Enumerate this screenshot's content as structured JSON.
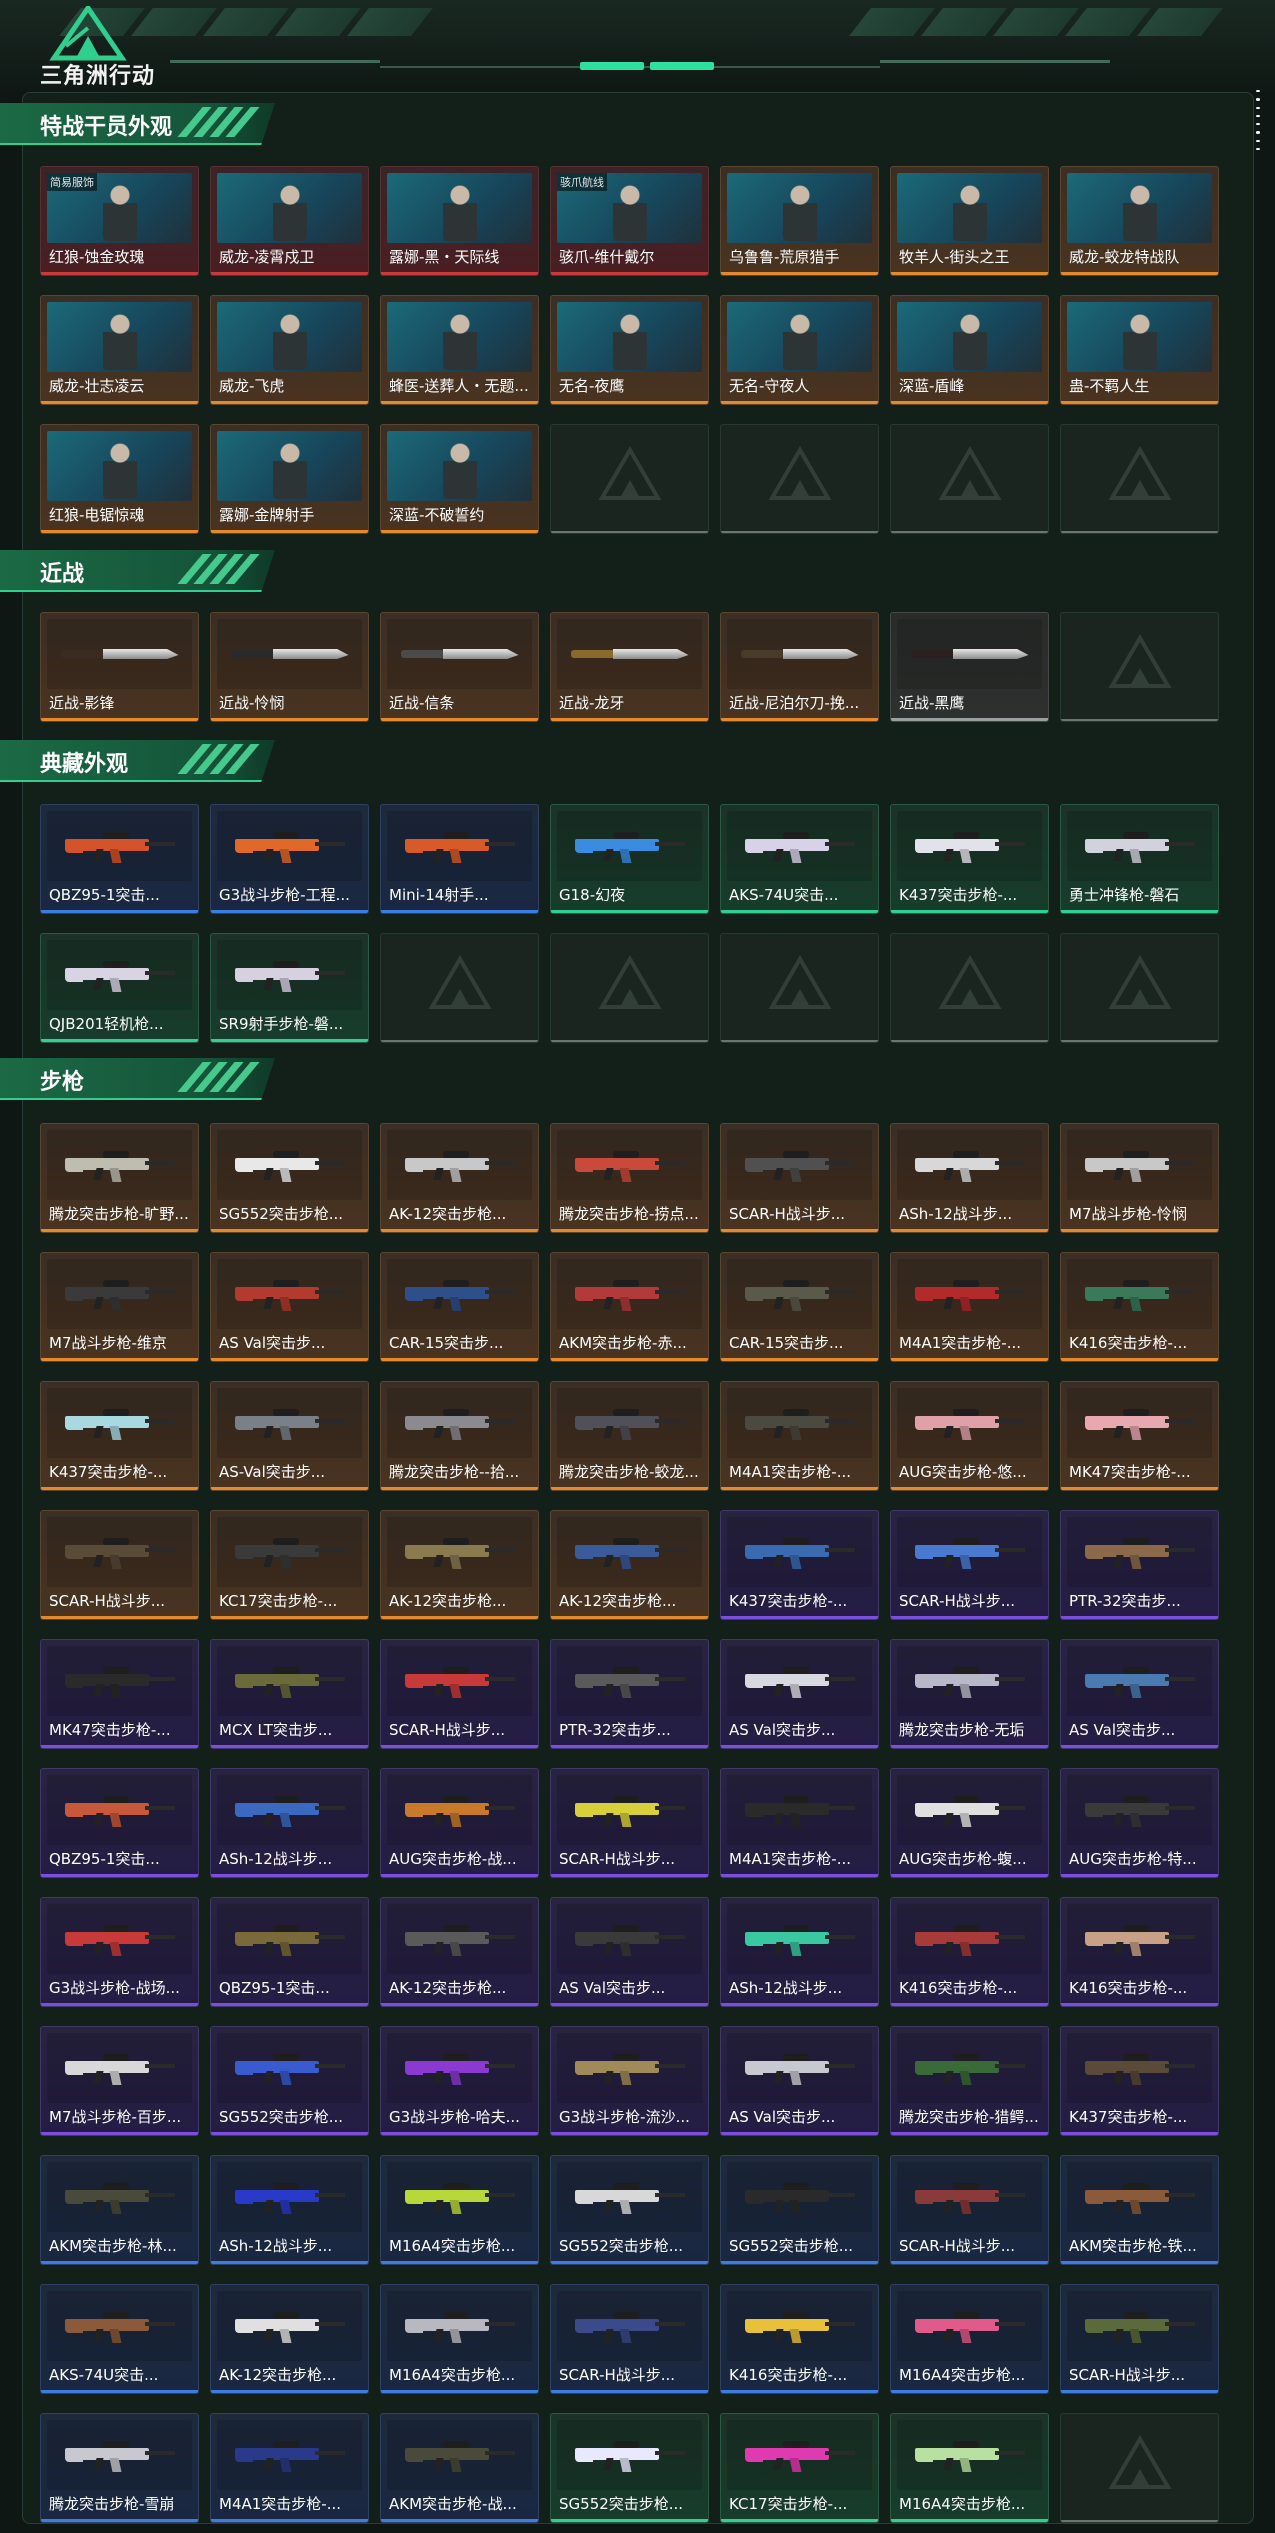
{
  "app": {
    "brand": "三角洲行动"
  },
  "sections": [
    {
      "id": "operators",
      "title": "特战干员外观",
      "kind": "operator",
      "items": [
        {
          "label": "红狼-蚀金玫瑰",
          "rarity": "red",
          "tag": "简易服饰"
        },
        {
          "label": "威龙-凌霄戍卫",
          "rarity": "red",
          "tag": ""
        },
        {
          "label": "露娜-黑・天际线",
          "rarity": "red",
          "tag": ""
        },
        {
          "label": "骇爪-维什戴尔",
          "rarity": "red",
          "tag": "骇爪航线"
        },
        {
          "label": "乌鲁鲁-荒原猎手",
          "rarity": "orange",
          "tag": ""
        },
        {
          "label": "牧羊人-街头之王",
          "rarity": "orange",
          "tag": ""
        },
        {
          "label": "威龙-蛟龙特战队",
          "rarity": "orange",
          "tag": ""
        },
        {
          "label": "威龙-壮志凌云",
          "rarity": "orange",
          "tag": ""
        },
        {
          "label": "威龙-飞虎",
          "rarity": "orange",
          "tag": ""
        },
        {
          "label": "蜂医-送葬人・无题...",
          "rarity": "orange",
          "tag": ""
        },
        {
          "label": "无名-夜鹰",
          "rarity": "orange",
          "tag": ""
        },
        {
          "label": "无名-守夜人",
          "rarity": "orange",
          "tag": ""
        },
        {
          "label": "深蓝-盾峰",
          "rarity": "orange",
          "tag": ""
        },
        {
          "label": "蛊-不羁人生",
          "rarity": "orange",
          "tag": ""
        },
        {
          "label": "红狼-电锯惊魂",
          "rarity": "orange",
          "tag": ""
        },
        {
          "label": "露娜-金牌射手",
          "rarity": "orange",
          "tag": ""
        },
        {
          "label": "深蓝-不破誓约",
          "rarity": "orange",
          "tag": ""
        },
        {
          "label": "",
          "rarity": "empty"
        },
        {
          "label": "",
          "rarity": "empty"
        },
        {
          "label": "",
          "rarity": "empty"
        },
        {
          "label": "",
          "rarity": "empty"
        }
      ]
    },
    {
      "id": "melee",
      "title": "近战",
      "kind": "knife",
      "items": [
        {
          "label": "近战-影锋",
          "rarity": "orange"
        },
        {
          "label": "近战-怜悯",
          "rarity": "orange"
        },
        {
          "label": "近战-信条",
          "rarity": "orange"
        },
        {
          "label": "近战-龙牙",
          "rarity": "orange"
        },
        {
          "label": "近战-尼泊尔刀-挽...",
          "rarity": "orange"
        },
        {
          "label": "近战-黑鹰",
          "rarity": "gray"
        },
        {
          "label": "",
          "rarity": "empty"
        }
      ]
    },
    {
      "id": "collection",
      "title": "典藏外观",
      "kind": "gun",
      "items": [
        {
          "label": "QBZ95-1突击...",
          "rarity": "blue",
          "color": "#d5532b"
        },
        {
          "label": "G3战斗步枪-工程...",
          "rarity": "blue",
          "color": "#e0692a"
        },
        {
          "label": "Mini-14射手...",
          "rarity": "blue",
          "color": "#d85a28"
        },
        {
          "label": "G18-幻夜",
          "rarity": "green",
          "color": "#3a8ce0"
        },
        {
          "label": "AKS-74U突击...",
          "rarity": "green",
          "color": "#d8d2e8"
        },
        {
          "label": "K437突击步枪-...",
          "rarity": "green",
          "color": "#e2e2ea"
        },
        {
          "label": "勇士冲锋枪-磐石",
          "rarity": "green",
          "color": "#d2d2dc"
        },
        {
          "label": "QJB201轻机枪...",
          "rarity": "green",
          "color": "#d8d4e4"
        },
        {
          "label": "SR9射手步枪-磐...",
          "rarity": "green",
          "color": "#d6d0e0"
        },
        {
          "label": "",
          "rarity": "empty"
        },
        {
          "label": "",
          "rarity": "empty"
        },
        {
          "label": "",
          "rarity": "empty"
        },
        {
          "label": "",
          "rarity": "empty"
        },
        {
          "label": "",
          "rarity": "empty"
        }
      ]
    },
    {
      "id": "rifles",
      "title": "步枪",
      "kind": "gun",
      "items": [
        {
          "label": "腾龙突击步枪-旷野...",
          "rarity": "orange",
          "color": "#bdbdb0"
        },
        {
          "label": "SG552突击步枪...",
          "rarity": "orange",
          "color": "#e8e8e8"
        },
        {
          "label": "AK-12突击步枪...",
          "rarity": "orange",
          "color": "#c8c8c8"
        },
        {
          "label": "腾龙突击步枪-捞点...",
          "rarity": "orange",
          "color": "#c94a3a"
        },
        {
          "label": "SCAR-H战斗步...",
          "rarity": "orange",
          "color": "#505050"
        },
        {
          "label": "ASh-12战斗步...",
          "rarity": "orange",
          "color": "#d8d8d8"
        },
        {
          "label": "M7战斗步枪-怜悯",
          "rarity": "orange",
          "color": "#c8c8c8"
        },
        {
          "label": "M7战斗步枪-维京",
          "rarity": "orange",
          "color": "#3a3a3a"
        },
        {
          "label": "AS Val突击步...",
          "rarity": "orange",
          "color": "#b23a2e"
        },
        {
          "label": "CAR-15突击步...",
          "rarity": "orange",
          "color": "#2f4f8a"
        },
        {
          "label": "AKM突击步枪-赤...",
          "rarity": "orange",
          "color": "#b23a3a"
        },
        {
          "label": "CAR-15突击步...",
          "rarity": "orange",
          "color": "#5a5a4a"
        },
        {
          "label": "M4A1突击步枪-...",
          "rarity": "orange",
          "color": "#b22a2a"
        },
        {
          "label": "K416突击步枪-...",
          "rarity": "orange",
          "color": "#3a7a5a"
        },
        {
          "label": "K437突击步枪-...",
          "rarity": "orange",
          "color": "#a8d8e0"
        },
        {
          "label": "AS-Val突击步...",
          "rarity": "orange",
          "color": "#7a8088"
        },
        {
          "label": "腾龙突击步枪--拾...",
          "rarity": "orange",
          "color": "#8a8a90"
        },
        {
          "label": "腾龙突击步枪-蛟龙...",
          "rarity": "orange",
          "color": "#505058"
        },
        {
          "label": "M4A1突击步枪-...",
          "rarity": "orange",
          "color": "#4a4a40"
        },
        {
          "label": "AUG突击步枪-悠...",
          "rarity": "orange",
          "color": "#e0a0a8"
        },
        {
          "label": "MK47突击步枪-...",
          "rarity": "orange",
          "color": "#e8a8b0"
        },
        {
          "label": "SCAR-H战斗步...",
          "rarity": "orange",
          "color": "#5a4a38"
        },
        {
          "label": "KC17突击步枪-...",
          "rarity": "orange",
          "color": "#3a3a3a"
        },
        {
          "label": "AK-12突击步枪...",
          "rarity": "orange",
          "color": "#8a7a50"
        },
        {
          "label": "AK-12突击步枪...",
          "rarity": "orange",
          "color": "#3a5a9a"
        },
        {
          "label": "K437突击步枪-...",
          "rarity": "purple",
          "color": "#3a6ab0"
        },
        {
          "label": "SCAR-H战斗步...",
          "rarity": "purple",
          "color": "#4a7ad0"
        },
        {
          "label": "PTR-32突击步...",
          "rarity": "purple",
          "color": "#8a6a4a"
        },
        {
          "label": "MK47突击步枪-...",
          "rarity": "purple",
          "color": "#2a2a2a"
        },
        {
          "label": "MCX LT突击步...",
          "rarity": "purple",
          "color": "#6a6a3a"
        },
        {
          "label": "SCAR-H战斗步...",
          "rarity": "purple",
          "color": "#c83a3a"
        },
        {
          "label": "PTR-32突击步...",
          "rarity": "purple",
          "color": "#5a5a5a"
        },
        {
          "label": "AS Val突击步...",
          "rarity": "purple",
          "color": "#d8d8e0"
        },
        {
          "label": "腾龙突击步枪-无垢",
          "rarity": "purple",
          "color": "#b8b8c8"
        },
        {
          "label": "AS Val突击步...",
          "rarity": "purple",
          "color": "#4a7ab0"
        },
        {
          "label": "QBZ95-1突击...",
          "rarity": "purple",
          "color": "#c8583a"
        },
        {
          "label": "ASh-12战斗步...",
          "rarity": "purple",
          "color": "#3a6ac0"
        },
        {
          "label": "AUG突击步枪-战...",
          "rarity": "purple",
          "color": "#c87a2a"
        },
        {
          "label": "SCAR-H战斗步...",
          "rarity": "purple",
          "color": "#d8d03a"
        },
        {
          "label": "M4A1突击步枪-...",
          "rarity": "purple",
          "color": "#2a2a2a"
        },
        {
          "label": "AUG突击步枪-蝮...",
          "rarity": "purple",
          "color": "#e0e0e0"
        },
        {
          "label": "AUG突击步枪-特...",
          "rarity": "purple",
          "color": "#3a3a3a"
        },
        {
          "label": "G3战斗步枪-战场...",
          "rarity": "purple",
          "color": "#c83a3a"
        },
        {
          "label": "QBZ95-1突击...",
          "rarity": "purple",
          "color": "#7a6a3a"
        },
        {
          "label": "AK-12突击步枪...",
          "rarity": "purple",
          "color": "#5a5a5a"
        },
        {
          "label": "AS Val突击步...",
          "rarity": "purple",
          "color": "#3a3a3a"
        },
        {
          "label": "ASh-12战斗步...",
          "rarity": "purple",
          "color": "#3ac8a0"
        },
        {
          "label": "K416突击步枪-...",
          "rarity": "purple",
          "color": "#a83a3a"
        },
        {
          "label": "K416突击步枪-...",
          "rarity": "purple",
          "color": "#c8a088"
        },
        {
          "label": "M7战斗步枪-百步...",
          "rarity": "purple",
          "color": "#d8d8d8"
        },
        {
          "label": "SG552突击步枪...",
          "rarity": "purple",
          "color": "#3a5ad0"
        },
        {
          "label": "G3战斗步枪-哈夫...",
          "rarity": "purple",
          "color": "#8a3ad0"
        },
        {
          "label": "G3战斗步枪-流沙...",
          "rarity": "purple",
          "color": "#a08a5a"
        },
        {
          "label": "AS Val突击步...",
          "rarity": "purple",
          "color": "#c8c8d0"
        },
        {
          "label": "腾龙突击步枪-猎鳄...",
          "rarity": "purple",
          "color": "#3a6a3a"
        },
        {
          "label": "K437突击步枪-...",
          "rarity": "purple",
          "color": "#5a4a3a"
        },
        {
          "label": "AKM突击步枪-林...",
          "rarity": "blue",
          "color": "#4a4a3a"
        },
        {
          "label": "ASh-12战斗步...",
          "rarity": "blue",
          "color": "#2a3ac8"
        },
        {
          "label": "M16A4突击步枪...",
          "rarity": "blue",
          "color": "#b8d83a"
        },
        {
          "label": "SG552突击步枪...",
          "rarity": "blue",
          "color": "#d8d8d8"
        },
        {
          "label": "SG552突击步枪...",
          "rarity": "blue",
          "color": "#2a2a2a"
        },
        {
          "label": "SCAR-H战斗步...",
          "rarity": "blue",
          "color": "#8a3a3a"
        },
        {
          "label": "AKM突击步枪-铁...",
          "rarity": "blue",
          "color": "#8a5a3a"
        },
        {
          "label": "AKS-74U突击...",
          "rarity": "blue",
          "color": "#8a5a3a"
        },
        {
          "label": "AK-12突击步枪...",
          "rarity": "blue",
          "color": "#e0e0e0"
        },
        {
          "label": "M16A4突击步枪...",
          "rarity": "blue",
          "color": "#b8b8c0"
        },
        {
          "label": "SCAR-H战斗步...",
          "rarity": "blue",
          "color": "#3a4a8a"
        },
        {
          "label": "K416突击步枪-...",
          "rarity": "blue",
          "color": "#e8c03a"
        },
        {
          "label": "M16A4突击步枪...",
          "rarity": "blue",
          "color": "#e05a8a"
        },
        {
          "label": "SCAR-H战斗步...",
          "rarity": "blue",
          "color": "#5a6a3a"
        },
        {
          "label": "腾龙突击步枪-雪崩",
          "rarity": "blue",
          "color": "#c8c8d0"
        },
        {
          "label": "M4A1突击步枪-...",
          "rarity": "blue",
          "color": "#2a3a8a"
        },
        {
          "label": "AKM突击步枪-战...",
          "rarity": "blue",
          "color": "#4a4a3a"
        },
        {
          "label": "SG552突击步枪...",
          "rarity": "green",
          "color": "#e8e8ff"
        },
        {
          "label": "KC17突击步枪-...",
          "rarity": "green",
          "color": "#e03ab0"
        },
        {
          "label": "M16A4突击步枪...",
          "rarity": "green",
          "color": "#b8e0a0"
        },
        {
          "label": "",
          "rarity": "empty"
        }
      ]
    }
  ]
}
